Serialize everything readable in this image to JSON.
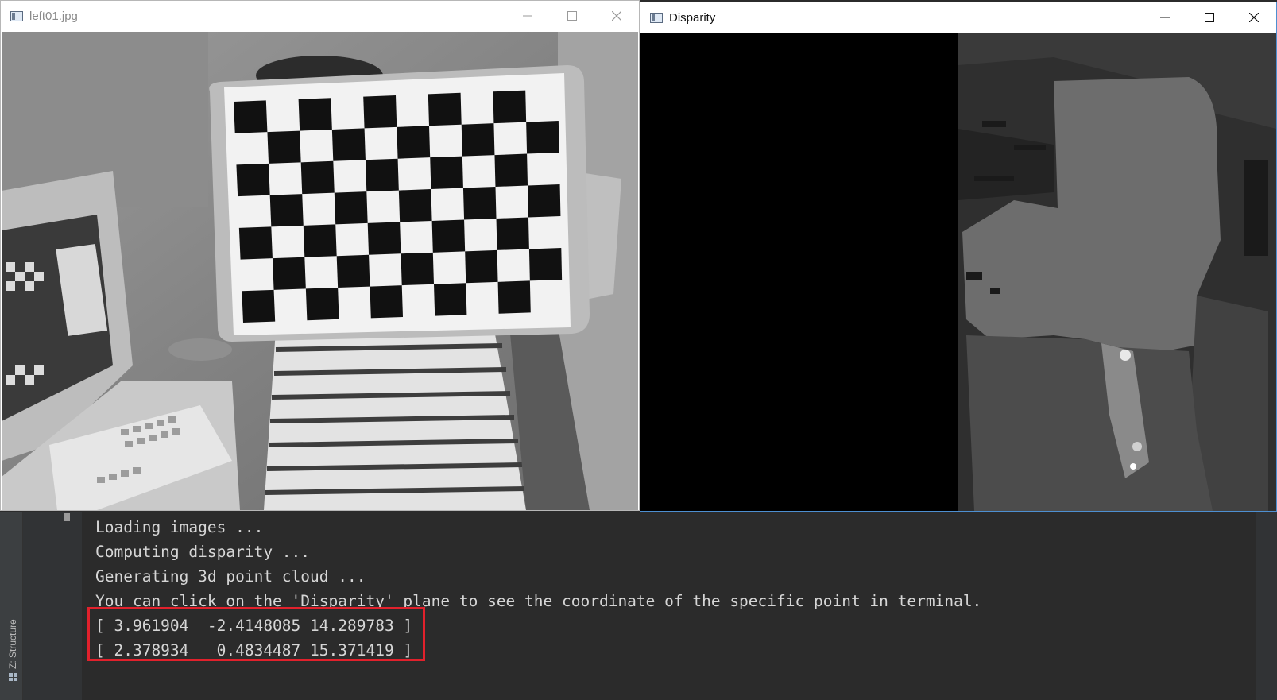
{
  "left_window": {
    "title": "left01.jpg",
    "image_description": "stereo camera left image: person holding chessboard calibration pattern"
  },
  "right_window": {
    "title": "Disparity"
  },
  "window_controls": {
    "minimize": "minimize-icon",
    "maximize": "maximize-icon",
    "close": "close-icon"
  },
  "terminal": {
    "lines": [
      "Loading images ...",
      "Computing disparity ...",
      "Generating 3d point cloud ...",
      "You can click on the 'Disparity' plane to see the coordinate of the specific point in terminal.",
      "[ 3.961904  -2.4148085 14.289783 ]",
      "[ 2.378934   0.4834487 15.371419 ]"
    ]
  },
  "sidebar": {
    "structure_label": "Z: Structure"
  },
  "colors": {
    "highlight": "#e1212c",
    "terminal_bg": "#2b2b2b",
    "terminal_text": "#d6d6d6",
    "active_border": "#4d8fd1"
  }
}
